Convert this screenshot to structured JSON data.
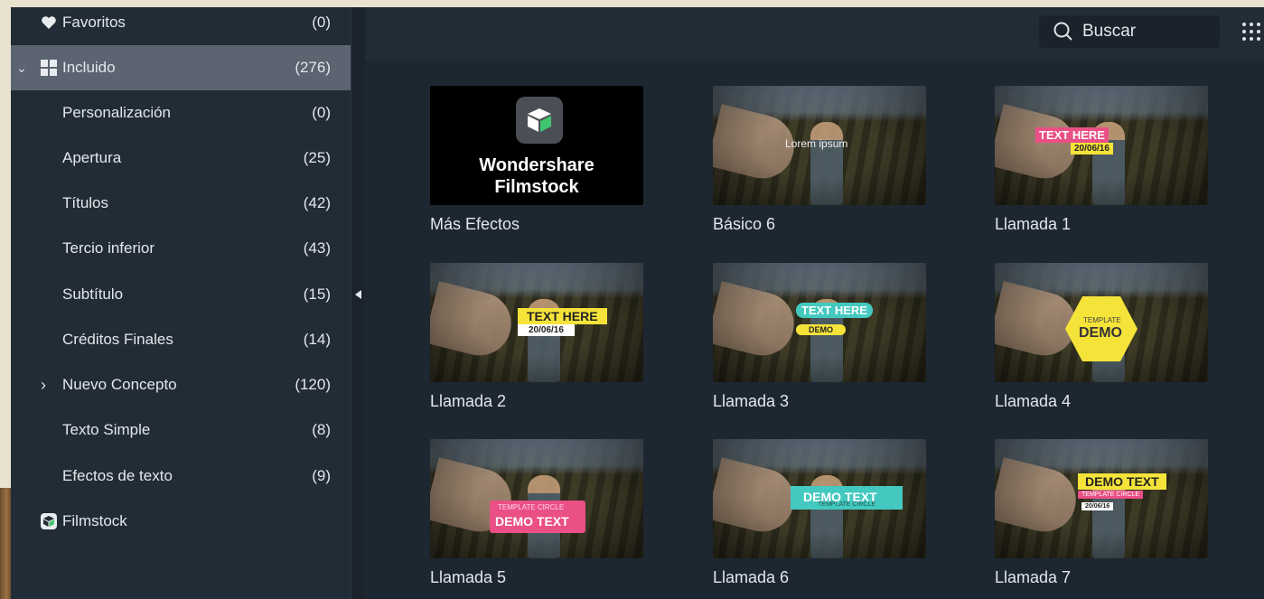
{
  "sidebar": {
    "items": [
      {
        "label": "Favoritos",
        "count": "(0)",
        "icon": "heart-icon"
      },
      {
        "label": "Incluido",
        "count": "(276)",
        "icon": "grid-icon",
        "chevron": "⌄"
      },
      {
        "label": "Personalización",
        "count": "(0)"
      },
      {
        "label": "Apertura",
        "count": "(25)"
      },
      {
        "label": "Títulos",
        "count": "(42)"
      },
      {
        "label": "Tercio inferior",
        "count": "(43)"
      },
      {
        "label": "Subtítulo",
        "count": "(15)"
      },
      {
        "label": "Créditos Finales",
        "count": "(14)"
      },
      {
        "label": "Nuevo Concepto",
        "count": "(120)",
        "chevron": "›"
      },
      {
        "label": "Texto Simple",
        "count": "(8)"
      },
      {
        "label": "Efectos de texto",
        "count": "(9)"
      },
      {
        "label": "Filmstock",
        "icon": "filmstock-icon"
      }
    ]
  },
  "search": {
    "placeholder": "Buscar"
  },
  "promo": {
    "line1": "Wondershare",
    "line2": "Filmstock"
  },
  "cards": [
    {
      "caption": "Más Efectos"
    },
    {
      "caption": "Básico 6",
      "overlay": [
        "Lorem ipsum"
      ]
    },
    {
      "caption": "Llamada 1",
      "overlay": [
        "TEXT HERE",
        "20/06/16"
      ]
    },
    {
      "caption": "Llamada 2",
      "overlay": [
        "TEXT HERE",
        "20/06/16"
      ]
    },
    {
      "caption": "Llamada 3",
      "overlay": [
        "TEXT HERE",
        "DEMO"
      ]
    },
    {
      "caption": "Llamada 4",
      "overlay": [
        "TEMPLATE",
        "DEMO"
      ]
    },
    {
      "caption": "Llamada 5",
      "overlay": [
        "TEMPLATE CIRCLE",
        "DEMO TEXT"
      ]
    },
    {
      "caption": "Llamada 6",
      "overlay": [
        "DEMO TEXT",
        "TEMPLATE CIRCLE"
      ]
    },
    {
      "caption": "Llamada 7",
      "overlay": [
        "DEMO TEXT",
        "TEMPLATE CIRCLE",
        "20/06/16"
      ]
    }
  ],
  "colors": {
    "accent_yellow": "#f5e33a",
    "accent_pink": "#ea4f86",
    "accent_teal": "#44c9c0",
    "selected_row": "#5b6470"
  }
}
